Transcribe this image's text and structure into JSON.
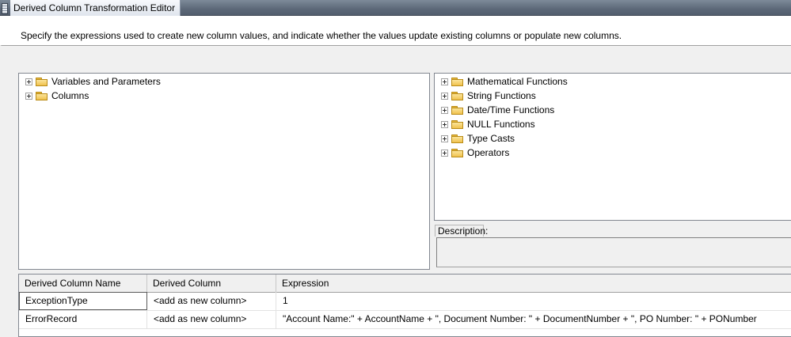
{
  "window": {
    "title": "Derived Column Transformation Editor"
  },
  "header": {
    "instructions": "Specify the expressions used to create new column values, and indicate whether the values update existing columns or populate new columns."
  },
  "left_tree": {
    "nodes": [
      {
        "label": "Variables and Parameters"
      },
      {
        "label": "Columns"
      }
    ]
  },
  "right_tree": {
    "nodes": [
      {
        "label": "Mathematical Functions"
      },
      {
        "label": "String Functions"
      },
      {
        "label": "Date/Time Functions"
      },
      {
        "label": "NULL Functions"
      },
      {
        "label": "Type Casts"
      },
      {
        "label": "Operators"
      }
    ]
  },
  "description": {
    "label": "Description:",
    "text": ""
  },
  "grid": {
    "columns": [
      "Derived Column Name",
      "Derived Column",
      "Expression"
    ],
    "rows": [
      {
        "name": "ExceptionType",
        "derived_column": "<add as new column>",
        "expression": "1"
      },
      {
        "name": "ErrorRecord",
        "derived_column": "<add as new column>",
        "expression": "\"Account Name:\" + AccountName + \", Document Number: \" + DocumentNumber + \", PO Number: \" + PONumber"
      }
    ]
  },
  "icons": {
    "tree_expander": "plus-expander-icon",
    "tree_folder": "folder-icon",
    "window_icon": "window-grip-icon"
  }
}
